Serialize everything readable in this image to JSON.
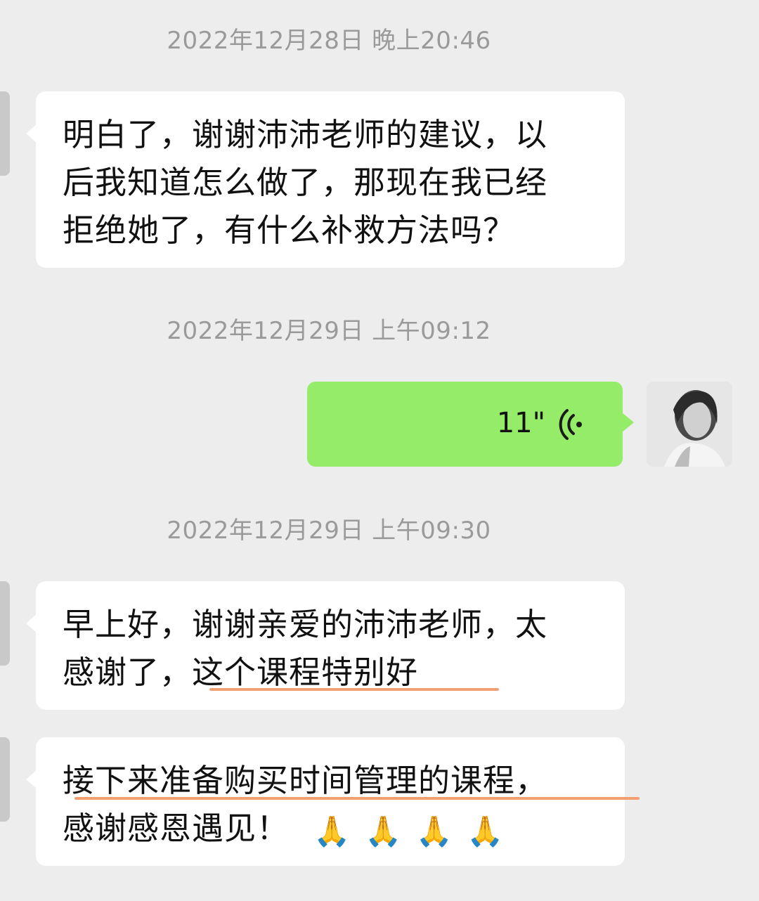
{
  "messages": [
    {
      "timestamp": "2022年12月28日 晚上20:46",
      "lines": [
        "明白了，谢谢沛沛老师的建议，以",
        "后我知道怎么做了，那现在我已经",
        "拒绝她了，有什么补救方法吗？"
      ]
    },
    {
      "timestamp": "2022年12月29日 上午09:12",
      "voice_duration": "11\""
    },
    {
      "timestamp": "2022年12月29日 上午09:30",
      "lines": [
        "早上好，谢谢亲爱的沛沛老师，太",
        "感谢了，这个课程特别好"
      ]
    },
    {
      "lines": [
        "接下来准备购买时间管理的课程，",
        "感谢感恩遇见！"
      ],
      "emoji": [
        "🙏",
        "🙏",
        "🙏",
        "🙏"
      ]
    }
  ],
  "colors": {
    "background": "#ededed",
    "bubble_received": "#ffffff",
    "bubble_sent": "#95ec69",
    "underline_highlight": "#f0a073"
  },
  "icons": {
    "voice": "voice-wave-icon",
    "avatar": "user-avatar"
  }
}
